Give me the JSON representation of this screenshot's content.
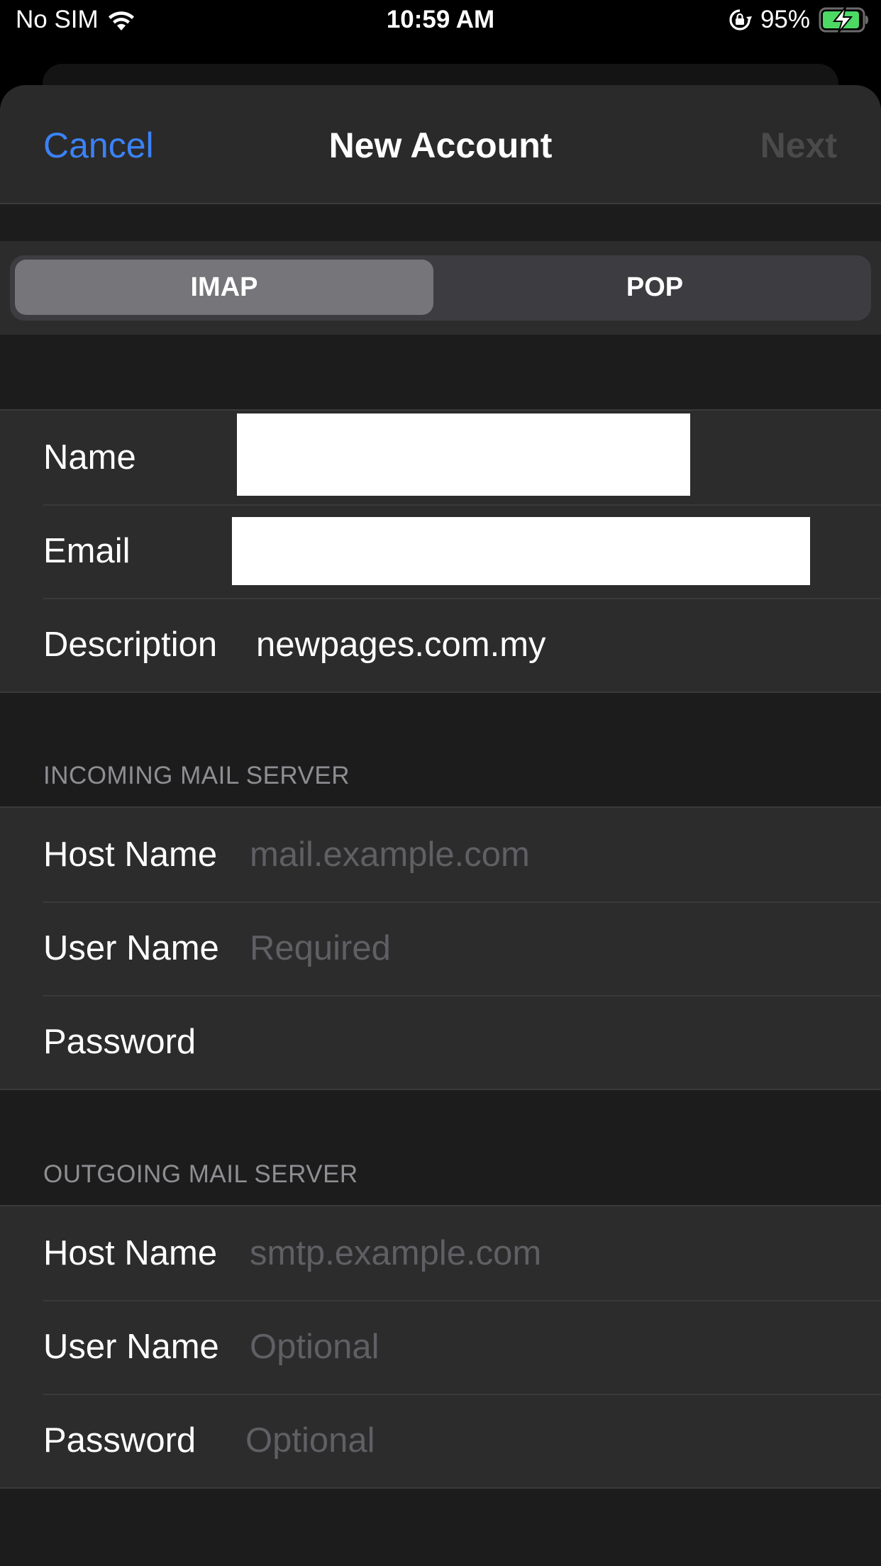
{
  "status_bar": {
    "carrier": "No SIM",
    "time": "10:59 AM",
    "battery_percent": "95%",
    "battery_level": 0.95,
    "battery_charging": true,
    "icons": [
      "wifi-icon",
      "lock-rotation-icon",
      "battery-icon"
    ],
    "battery_color": "#4cd964"
  },
  "nav": {
    "cancel_label": "Cancel",
    "title": "New Account",
    "next_label": "Next",
    "accent_color": "#3b82f6"
  },
  "segmented": {
    "options": [
      "IMAP",
      "POP"
    ],
    "selected": "IMAP"
  },
  "account": {
    "rows": [
      {
        "label": "Name",
        "value": "",
        "redacted": true
      },
      {
        "label": "Email",
        "value": "",
        "redacted": true
      },
      {
        "label": "Description",
        "value": "newpages.com.my"
      }
    ]
  },
  "incoming": {
    "header": "INCOMING MAIL SERVER",
    "rows": [
      {
        "label": "Host Name",
        "placeholder": "mail.example.com"
      },
      {
        "label": "User Name",
        "placeholder": "Required"
      },
      {
        "label": "Password",
        "placeholder": ""
      }
    ]
  },
  "outgoing": {
    "header": "OUTGOING MAIL SERVER",
    "rows": [
      {
        "label": "Host Name",
        "placeholder": "smtp.example.com"
      },
      {
        "label": "User Name",
        "placeholder": "Optional"
      },
      {
        "label": "Password",
        "placeholder": "Optional"
      }
    ]
  }
}
